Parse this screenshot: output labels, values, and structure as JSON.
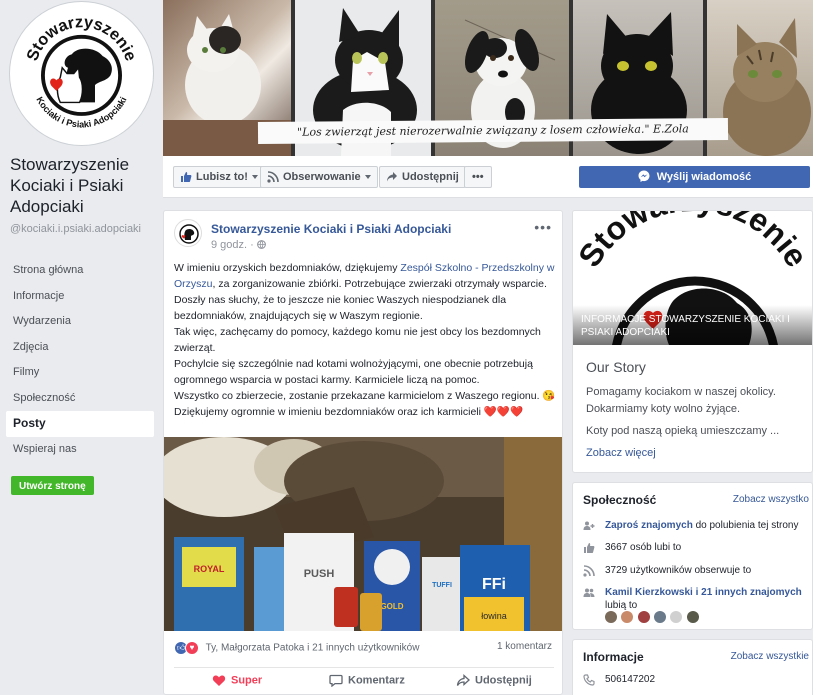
{
  "page": {
    "name": "Stowarzyszenie Kociaki i Psiaki Adopciaki",
    "handle": "@kociaki.i.psiaki.adopciaki",
    "logo_text_top": "Stowarzyszenie",
    "logo_text_bottom": "Kociaki i Psiaki Adopciaki"
  },
  "left_nav": {
    "items": [
      {
        "label": "Strona główna",
        "active": false
      },
      {
        "label": "Informacje",
        "active": false
      },
      {
        "label": "Wydarzenia",
        "active": false
      },
      {
        "label": "Zdjęcia",
        "active": false
      },
      {
        "label": "Filmy",
        "active": false
      },
      {
        "label": "Społeczność",
        "active": false
      },
      {
        "label": "Posty",
        "active": true
      },
      {
        "label": "Wspieraj nas",
        "active": false
      }
    ],
    "create_page": "Utwórz stronę"
  },
  "cover": {
    "quote": "\"Los zwierząt jest nierozerwalnie związany z losem człowieka.\"  E.Zola"
  },
  "action_bar": {
    "like": "Lubisz to!",
    "follow": "Obserwowanie",
    "share": "Udostępnij",
    "more": "•••",
    "message": "Wyślij wiadomość"
  },
  "post": {
    "author": "Stowarzyszenie Kociaki i Psiaki Adopciaki",
    "time": "9 godz. · ",
    "menu": "•••",
    "text_1": "W imieniu orzyskich bezdomniaków, dziękujemy ",
    "text_link": "Zespół Szkolno - Przedszkolny w Orzyszu",
    "text_2": ", za zorganizowanie zbiórki. Potrzebujące zwierzaki otrzymały wsparcie. Doszły nas słuchy, że to jeszcze nie koniec Waszych niespodzianek dla bezdomniaków, znajdujących się w Waszym regionie.",
    "text_3": "Tak więc, zachęcamy do pomocy, każdego komu nie jest obcy los bezdomnych zwierząt.",
    "text_4": "Pochylcie się szczególnie nad kotami wolnożyjącymi, one obecnie potrzebują ogromnego wsparcia w postaci karmy. Karmiciele liczą na pomoc.",
    "text_5": "Wszystko co zbierzecie, zostanie przekazane karmicielom z Waszego regionu. 😘",
    "text_6": "Dziękujemy ogromnie w imieniu bezdomniaków oraz ich karmicieli ❤️❤️❤️",
    "reactions_text": "Ty, Małgorzata Patoka i 21 innych użytkowników",
    "comments_count": "1 komentarz",
    "actions": {
      "react": "Super",
      "comment": "Komentarz",
      "share": "Udostępnij"
    },
    "photo_labels": [
      "ROYAL",
      "PUSH",
      "GOLD",
      "TUFFI",
      "FFi",
      "łowina"
    ]
  },
  "story": {
    "banner_label": "INFORMACJE STOWARZYSZENIE KOCIAKI I PSIAKI ADOPCIAKI",
    "banner_logo_text": "Stowarzyszenie",
    "title": "Our Story",
    "line_1": "Pomagamy kociakom w naszej okolicy.",
    "line_2": "Dokarmiamy koty wolno żyjące.",
    "line_3": "Koty pod naszą opieką umieszczamy ...",
    "see_more": "Zobacz więcej"
  },
  "community": {
    "title": "Społeczność",
    "see_all": "Zobacz wszystko",
    "invite_link": "Zaproś znajomych",
    "invite_rest": " do polubienia tej strony",
    "likes": "3667 osób lubi to",
    "follows": "3729 użytkowników obserwuje to",
    "friends_link": "Kamil Kierzkowski i 21 innych znajomych",
    "friends_rest": "lubią to"
  },
  "info": {
    "title": "Informacje",
    "see_all": "Zobacz wszystkie",
    "phone": "506147202"
  },
  "colors": {
    "brand_blue": "#4267b2",
    "link": "#365899",
    "green": "#42b72a",
    "bg": "#e9ebee"
  }
}
